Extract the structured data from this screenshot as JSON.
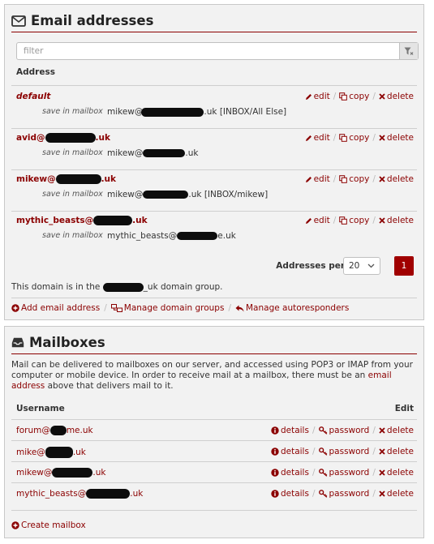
{
  "email_panel": {
    "title": "Email addresses",
    "filter_placeholder": "filter",
    "column_address": "Address",
    "addresses": [
      {
        "address": "default",
        "sub_label": "save in mailbox",
        "sub_prefix": "mikew@",
        "sub_mid": "",
        "sub_suffix": ".uk [INBOX/All Else]"
      },
      {
        "address_prefix": "avid@",
        "address_suffix": ".uk",
        "sub_label": "save in mailbox",
        "sub_prefix": "mikew@",
        "sub_suffix": ".uk"
      },
      {
        "address_prefix": "mikew@",
        "address_suffix": ".uk",
        "sub_label": "save in mailbox",
        "sub_prefix": "mikew@",
        "sub_suffix": ".uk [INBOX/mikew]"
      },
      {
        "address_prefix": "mythic_beasts@",
        "address_suffix": ".uk",
        "sub_label": "save in mailbox",
        "sub_prefix": "mythic_beasts@",
        "sub_suffix": "e.uk"
      }
    ],
    "actions": {
      "edit": "edit",
      "copy": "copy",
      "delete": "delete"
    },
    "per_page_label": "Addresses per page",
    "per_page_value": "20",
    "current_page": "1",
    "domain_note_prefix": "This domain is in the",
    "domain_note_mid": "_uk",
    "domain_note_suffix": "domain group.",
    "footer_links": {
      "add": "Add email address",
      "groups": "Manage domain groups",
      "autoresponders": "Manage autoresponders"
    }
  },
  "mailbox_panel": {
    "title": "Mailboxes",
    "desc_1": "Mail can be delivered to mailboxes on our server, and accessed using POP3 or IMAP from your computer or mobile device. In order to receive mail at a mailbox, there must be an ",
    "desc_link": "email address",
    "desc_2": " above that delivers mail to it.",
    "column_username": "Username",
    "column_edit": "Edit",
    "mailboxes": [
      {
        "prefix": "forum@",
        "suffix": "me.uk"
      },
      {
        "prefix": "mike@",
        "suffix": ".uk"
      },
      {
        "prefix": "mikew@",
        "suffix": ".uk"
      },
      {
        "prefix": "mythic_beasts@",
        "suffix": ".uk"
      }
    ],
    "actions": {
      "details": "details",
      "password": "password",
      "delete": "delete"
    },
    "create_link": "Create mailbox"
  },
  "colors": {
    "accent": "#8b0000",
    "button": "#a00000",
    "panel_bg": "#f2f2f2"
  }
}
